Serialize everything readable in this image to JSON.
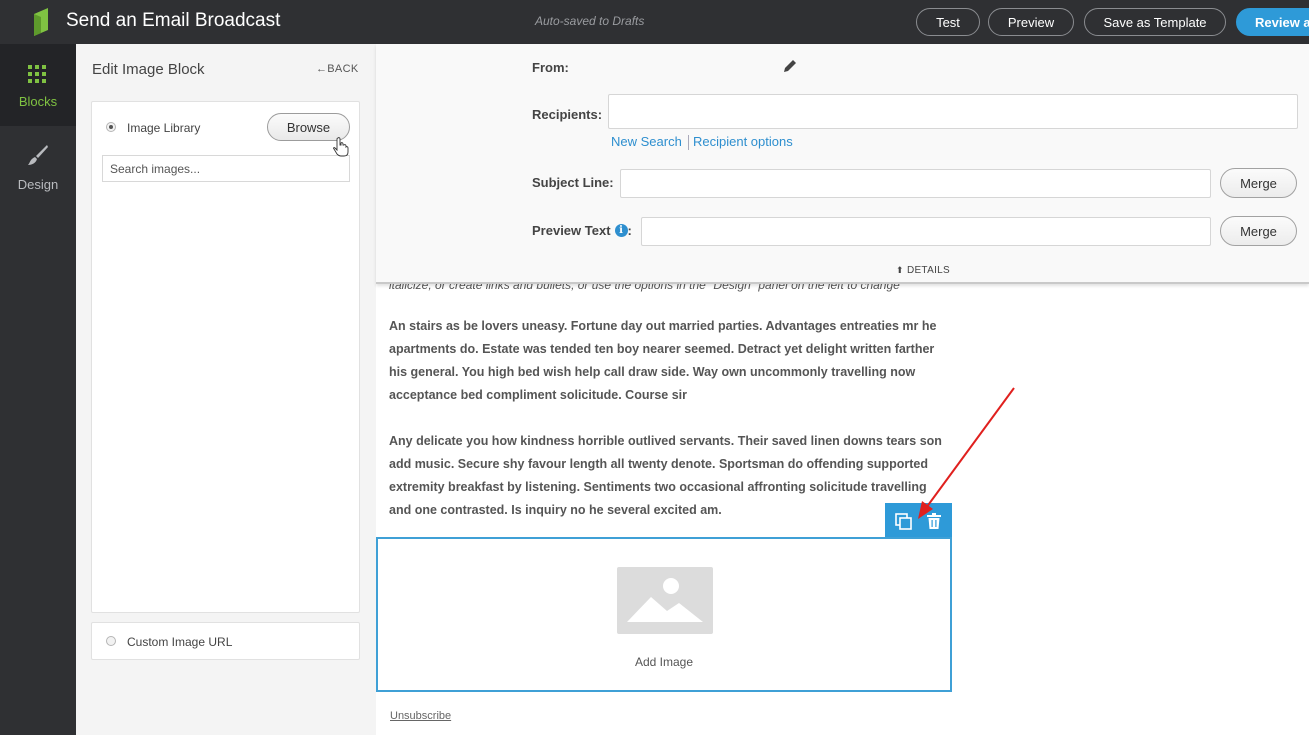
{
  "app": {
    "title": "Send an Email Broadcast",
    "autosave_status": "Auto-saved to Drafts"
  },
  "toolbar": {
    "test_label": "Test",
    "preview_label": "Preview",
    "save_template_label": "Save as Template",
    "review_label": "Review ar"
  },
  "rail": {
    "blocks_label": "Blocks",
    "design_label": "Design"
  },
  "panel": {
    "title": "Edit Image Block",
    "back_label": "←BACK",
    "image_library_label": "Image Library",
    "browse_label": "Browse",
    "search_placeholder": "Search images...",
    "custom_url_label": "Custom Image URL"
  },
  "details": {
    "from_label": "From:",
    "recipients_label": "Recipients:",
    "new_search_link": "New Search",
    "recipient_options_link": "Recipient options",
    "subject_label": "Subject Line:",
    "preview_text_label": "Preview Text",
    "preview_text_colon": ":",
    "merge_label": "Merge",
    "toggle_label": "DETAILS"
  },
  "canvas": {
    "cut_line_text": "italicize, or create links and bullets, or use the options in the \"Design\" panel on the left to change",
    "paragraph_1_lines": [
      "An stairs as be lovers uneasy. Fortune day out married parties. Advantages entreaties mr he",
      "apartments do. Estate was tended ten boy nearer seemed. Detract yet delight written farther",
      "his general. You high bed wish help call draw side. Way own uncommonly travelling now",
      "acceptance bed compliment solicitude. Course sir"
    ],
    "paragraph_2_lines": [
      "Any delicate you how kindness horrible outlived servants. Their saved linen downs tears son",
      "add music. Secure shy favour length all twenty denote. Sportsman do offending supported",
      "extremity breakfast by listening. Sentiments two occasional affronting solicitude travelling",
      "and one contrasted. Is inquiry no he several excited am."
    ],
    "add_image_label": "Add Image",
    "unsubscribe_label": "Unsubscribe"
  },
  "colors": {
    "topbar": "#2f3033",
    "accent": "#2e9ad8",
    "rail_active": "#7fc242",
    "link": "#2e8fcf",
    "annotation_arrow": "#e0201e"
  }
}
